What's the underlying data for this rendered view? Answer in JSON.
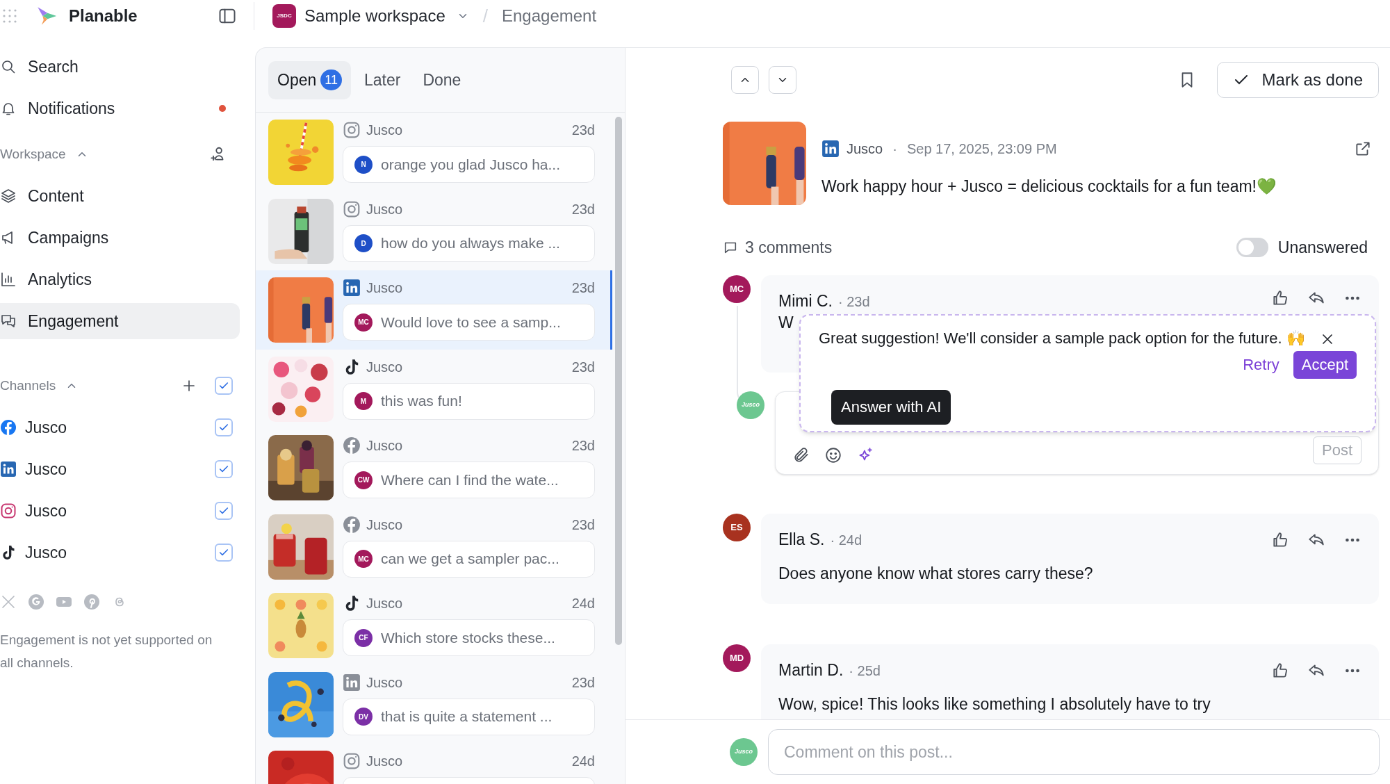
{
  "app": {
    "name": "Planable"
  },
  "breadcrumb": {
    "workspace_badge": "JSDC",
    "workspace": "Sample workspace",
    "separator": "/",
    "page": "Engagement"
  },
  "sidebar": {
    "top_items": [
      {
        "kind": "search",
        "label": "Search"
      },
      {
        "kind": "notifications",
        "label": "Notifications",
        "unread": true
      }
    ],
    "workspace": {
      "label": "Workspace",
      "expanded": true,
      "items": [
        {
          "label": "Content",
          "selected": false
        },
        {
          "label": "Campaigns",
          "selected": false
        },
        {
          "label": "Analytics",
          "selected": false
        },
        {
          "label": "Engagement",
          "selected": true
        }
      ]
    },
    "channels": {
      "label": "Channels",
      "expanded": true,
      "all_checked": true,
      "items": [
        {
          "kind": "facebook",
          "name": "Jusco",
          "checked": true
        },
        {
          "kind": "linkedin",
          "name": "Jusco",
          "checked": true
        },
        {
          "kind": "instagram",
          "name": "Jusco",
          "checked": true
        },
        {
          "kind": "tiktok",
          "name": "Jusco",
          "checked": true
        }
      ]
    },
    "note": "Engagement is not yet supported on all channels."
  },
  "list": {
    "tabs": [
      {
        "label": "Open",
        "count": "11",
        "selected": true
      },
      {
        "label": "Later",
        "selected": false
      },
      {
        "label": "Done",
        "selected": false
      }
    ],
    "items": [
      {
        "kind": "instagram",
        "account": "Jusco",
        "age": "23d",
        "initials": "N",
        "color": "#1e4fc7",
        "comment": "orange you glad Jusco ha...",
        "selected": false
      },
      {
        "kind": "instagram",
        "account": "Jusco",
        "age": "23d",
        "initials": "D",
        "color": "#1e4fc7",
        "comment": "how do you always make ...",
        "selected": false
      },
      {
        "kind": "linkedin",
        "account": "Jusco",
        "age": "23d",
        "initials": "MC",
        "color": "#a3195b",
        "comment": "Would love to see a samp...",
        "selected": true
      },
      {
        "kind": "tiktok",
        "account": "Jusco",
        "age": "23d",
        "initials": "M",
        "color": "#a3195b",
        "comment": "this was fun!",
        "selected": false
      },
      {
        "kind": "facebook",
        "account": "Jusco",
        "age": "23d",
        "initials": "CW",
        "color": "#a3195b",
        "comment": "Where can I find the wate...",
        "selected": false
      },
      {
        "kind": "facebook",
        "account": "Jusco",
        "age": "23d",
        "initials": "MC",
        "color": "#a3195b",
        "comment": "can we get a sampler pac...",
        "selected": false
      },
      {
        "kind": "tiktok",
        "account": "Jusco",
        "age": "24d",
        "initials": "CF",
        "color": "#7b2fa6",
        "comment": "Which store stocks these...",
        "selected": false
      },
      {
        "kind": "linkedin",
        "account": "Jusco",
        "age": "23d",
        "initials": "DV",
        "color": "#7b2fa6",
        "comment": "that is quite a statement ...",
        "selected": false
      },
      {
        "kind": "instagram",
        "account": "Jusco",
        "age": "24d",
        "selected": false
      }
    ]
  },
  "detail": {
    "mark_done": "Mark as done",
    "post": {
      "kind": "linkedin",
      "account": "Jusco",
      "separator": "·",
      "date": "Sep 17, 2025, 23:09 PM",
      "text": "Work happy hour + Jusco = delicious cocktails for a fun team!💚"
    },
    "comments_count": "3 comments",
    "unanswered": {
      "label": "Unanswered",
      "on": false
    },
    "comments": [
      {
        "initials": "MC",
        "color": "#a3195b",
        "name": "Mimi C.",
        "age": "· 23d",
        "text": "W"
      },
      {
        "initials": "ES",
        "color": "#a8321f",
        "name": "Ella S.",
        "age": "· 24d",
        "text": "Does anyone know what stores carry these?"
      },
      {
        "initials": "MD",
        "color": "#a3195b",
        "name": "Martin D.",
        "age": "· 25d",
        "text": "Wow, spice! This looks like something I absolutely have to try"
      }
    ],
    "reply": {
      "avatar": "Jusco",
      "post_button": "Post",
      "tooltip": "Answer with AI"
    },
    "ai_suggestion": {
      "text": "Great suggestion! We'll consider a sample pack option for the future. 🙌",
      "retry": "Retry",
      "accept": "Accept"
    },
    "composer": {
      "avatar": "Jusco",
      "placeholder": "Comment on this post..."
    }
  }
}
